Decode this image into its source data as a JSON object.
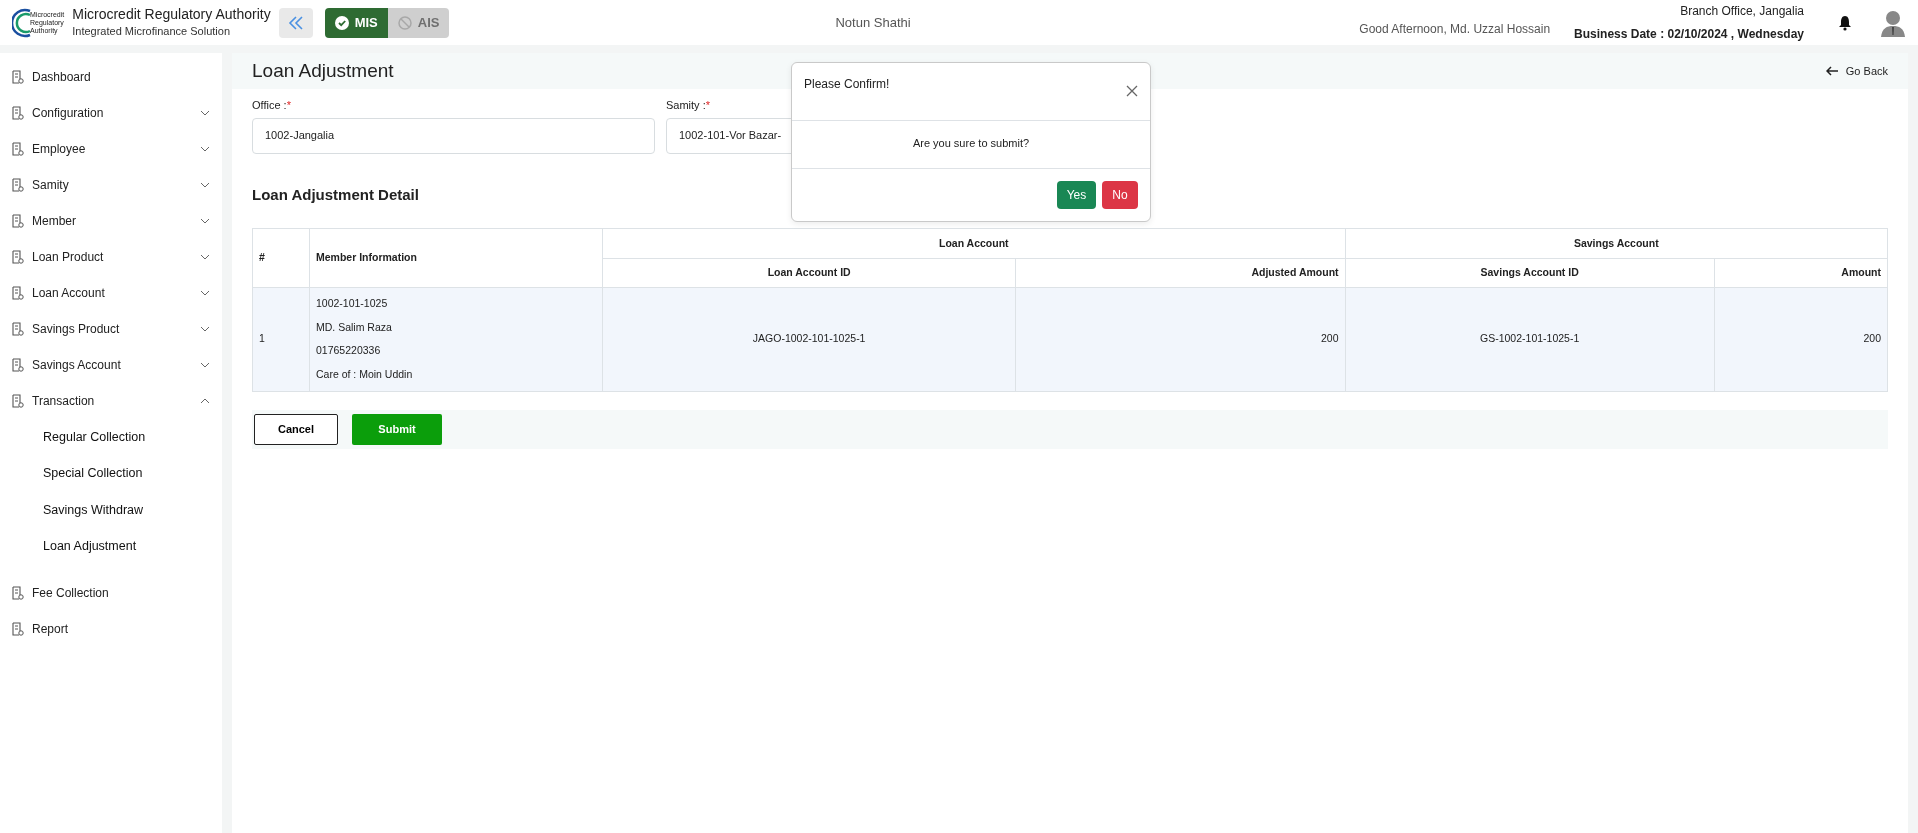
{
  "header": {
    "org_name": "Microcredit Regulatory Authority",
    "org_subtitle": "Integrated Microfinance Solution",
    "logo_text": [
      "Microcredit",
      "Regulatory",
      "Authority"
    ],
    "modules": [
      {
        "label": "MIS",
        "selected": true
      },
      {
        "label": "AIS",
        "selected": false
      }
    ],
    "app_name": "Notun Shathi",
    "greeting": "Good Afternoon, Md. Uzzal Hossain",
    "branch": "Branch Office, Jangalia",
    "business_date": "Business Date : 02/10/2024 , Wednesday"
  },
  "sidebar": {
    "items": [
      {
        "label": "Dashboard",
        "kind": "link"
      },
      {
        "label": "Configuration",
        "kind": "group",
        "expanded": false
      },
      {
        "label": "Employee",
        "kind": "group",
        "expanded": false
      },
      {
        "label": "Samity",
        "kind": "group",
        "expanded": false
      },
      {
        "label": "Member",
        "kind": "group",
        "expanded": false
      },
      {
        "label": "Loan Product",
        "kind": "group",
        "expanded": false
      },
      {
        "label": "Loan Account",
        "kind": "group",
        "expanded": false
      },
      {
        "label": "Savings Product",
        "kind": "group",
        "expanded": false
      },
      {
        "label": "Savings Account",
        "kind": "group",
        "expanded": false
      },
      {
        "label": "Transaction",
        "kind": "group",
        "expanded": true,
        "children": [
          {
            "label": "Regular Collection"
          },
          {
            "label": "Special Collection"
          },
          {
            "label": "Savings Withdraw"
          },
          {
            "label": "Loan Adjustment"
          }
        ]
      },
      {
        "label": "Fee Collection",
        "kind": "link"
      },
      {
        "label": "Report",
        "kind": "link"
      }
    ]
  },
  "page": {
    "title": "Loan Adjustment",
    "go_back": "Go Back",
    "fields": [
      {
        "label": "Office :",
        "required_mark": "*",
        "value": "1002-Jangalia"
      },
      {
        "label": "Samity :",
        "required_mark": "*",
        "value": "1002-101-Vor Bazar-"
      }
    ],
    "section_title": "Loan Adjustment Detail",
    "table": {
      "columns": [
        "#",
        "Member Information"
      ],
      "groups": [
        {
          "label": "Loan Account",
          "columns": [
            "Loan Account ID",
            "Adjusted Amount"
          ]
        },
        {
          "label": "Savings Account",
          "columns": [
            "Savings Account ID",
            "Amount"
          ]
        }
      ],
      "rows": [
        {
          "number": "1",
          "member_info": [
            "1002-101-1025",
            "MD. Salim Raza",
            "01765220336",
            "Care of : Moin Uddin"
          ],
          "cells": [
            "JAGO-1002-101-1025-1",
            "200",
            "GS-1002-101-1025-1",
            "200"
          ]
        }
      ]
    },
    "buttons": [
      {
        "label": "Cancel",
        "kind": "outline"
      },
      {
        "label": "Submit",
        "kind": "primary"
      }
    ]
  },
  "modal": {
    "title": "Please Confirm!",
    "message": "Are you sure to submit?",
    "buttons": [
      {
        "label": "Yes",
        "kind": "confirm"
      },
      {
        "label": "No",
        "kind": "deny"
      }
    ]
  }
}
